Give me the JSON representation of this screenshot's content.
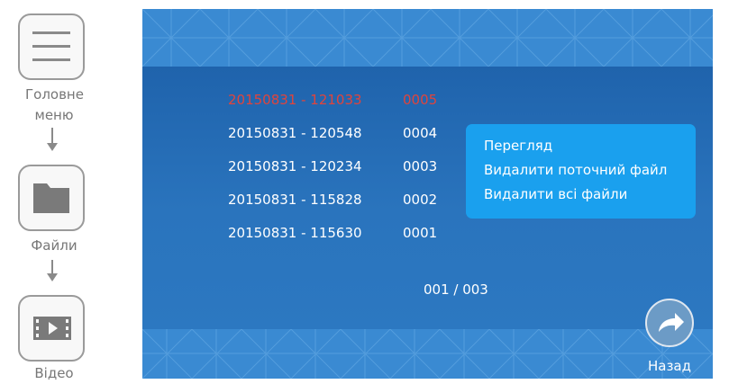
{
  "instructions": {
    "steps": [
      {
        "label": "Головне меню",
        "icon": "menu-icon"
      },
      {
        "label": "Файли",
        "icon": "folder-icon"
      },
      {
        "label": "Відео",
        "icon": "video-icon"
      }
    ]
  },
  "screen": {
    "records": [
      {
        "datetime": "20150831 - 121033",
        "number": "0005",
        "selected": true
      },
      {
        "datetime": "20150831 - 120548",
        "number": "0004",
        "selected": false
      },
      {
        "datetime": "20150831 - 120234",
        "number": "0003",
        "selected": false
      },
      {
        "datetime": "20150831 - 115828",
        "number": "0002",
        "selected": false
      },
      {
        "datetime": "20150831 - 115630",
        "number": "0001",
        "selected": false
      }
    ],
    "context_menu": {
      "items": [
        "Перегляд",
        "Видалити поточний файл",
        "Видалити всі файли"
      ]
    },
    "pager": "001 / 003",
    "back": {
      "label": "Назад",
      "icon": "back-arrow-icon"
    }
  },
  "colors": {
    "screen_bg": "#2169b0",
    "band": "#3a8ad2",
    "selected_text": "#e0443c",
    "menu_bg": "#1aa0ee"
  }
}
